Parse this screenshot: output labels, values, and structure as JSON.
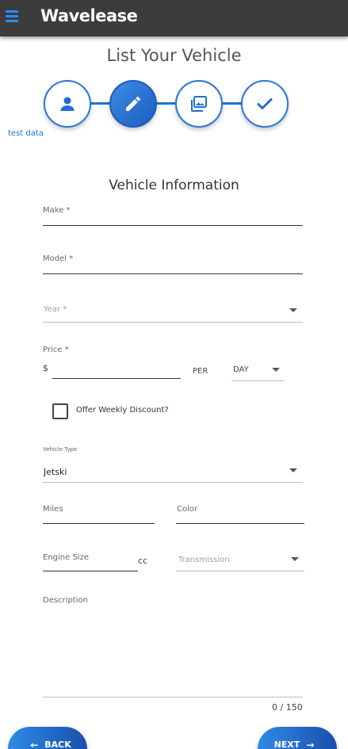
{
  "app": {
    "brand": "Wavelease"
  },
  "page": {
    "title": "List Your Vehicle"
  },
  "stepper": {
    "steps": [
      {
        "icon": "person-icon",
        "active": false
      },
      {
        "icon": "pencil-icon",
        "active": true
      },
      {
        "icon": "photos-icon",
        "active": false
      },
      {
        "icon": "check-icon",
        "active": false
      }
    ]
  },
  "test_data_link": "test data",
  "section_title": "Vehicle Information",
  "form": {
    "make": {
      "label": "Make *",
      "value": ""
    },
    "model": {
      "label": "Model *",
      "value": ""
    },
    "year": {
      "label": "Year *",
      "value": ""
    },
    "price": {
      "label": "Price *",
      "currency": "$",
      "value": "",
      "per_label": "PER",
      "period": "DAY"
    },
    "weekly_discount": {
      "label": "Offer Weekly Discount?",
      "checked": false
    },
    "vehicle_type": {
      "label": "Vehicle Type",
      "value": "Jetski"
    },
    "miles": {
      "label": "Miles",
      "value": ""
    },
    "color": {
      "label": "Color",
      "value": ""
    },
    "engine_size": {
      "label": "Engine Size",
      "unit": "cc",
      "value": ""
    },
    "transmission": {
      "label": "Transmission",
      "value": ""
    },
    "description": {
      "label": "Description",
      "value": "",
      "counter": "0 / 150"
    }
  },
  "buttons": {
    "back": "BACK",
    "next": "NEXT"
  },
  "colors": {
    "topbar": "#3c3c3c",
    "accent": "#2a78d4",
    "accent_dark": "#1d5bbf"
  }
}
